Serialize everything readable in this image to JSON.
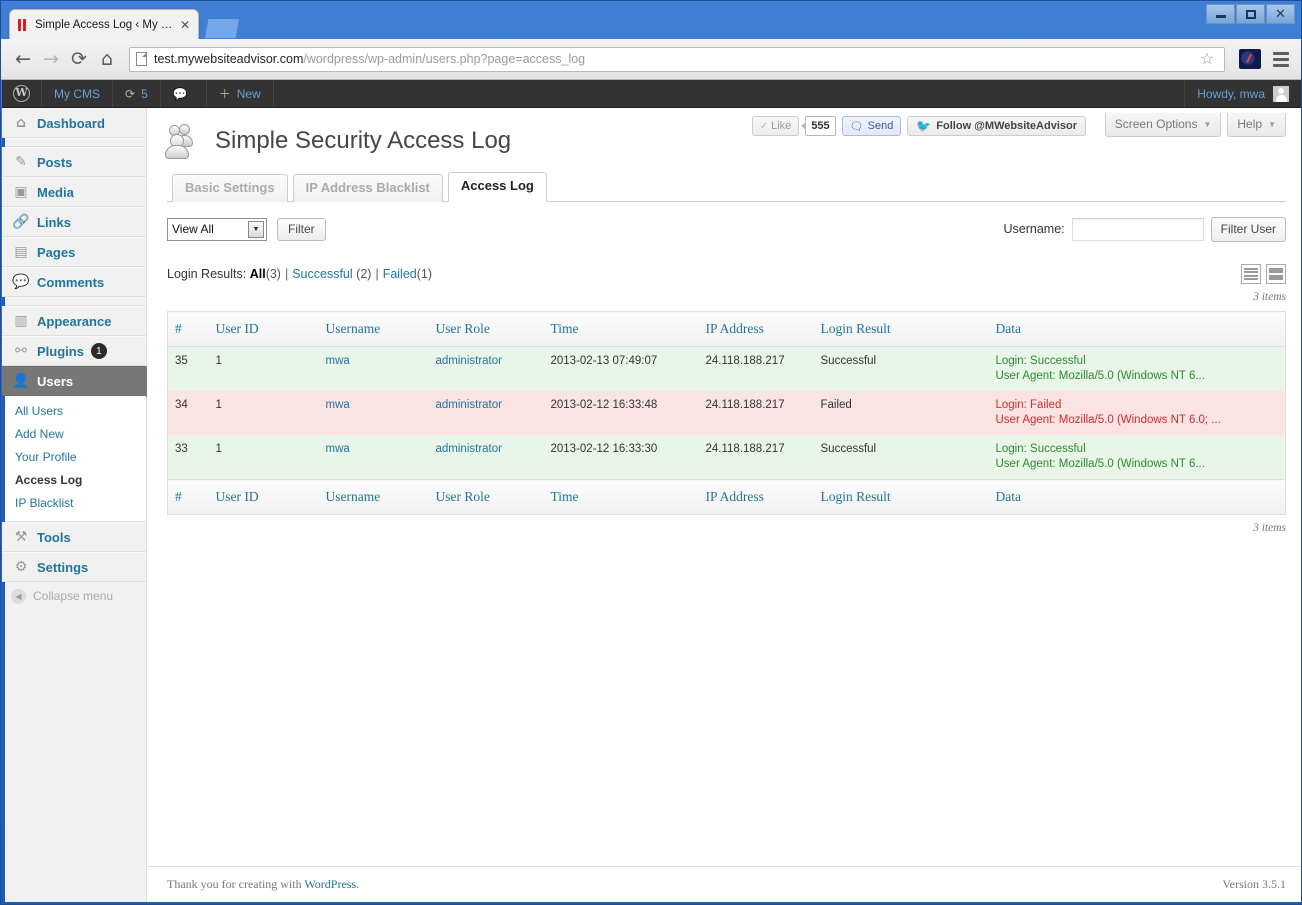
{
  "browser": {
    "tab_title": "Simple Access Log ‹ My CMS",
    "tab_close": "✕",
    "url_host": "test.mywebsiteadvisor.com",
    "url_path": "/wordpress/wp-admin/users.php?page=access_log",
    "back_glyph": "←",
    "forward_glyph": "→",
    "reload_glyph": "⟳",
    "home_glyph": "⌂",
    "star_glyph": "☆",
    "minimize_glyph": "",
    "maximize_glyph": "",
    "close_glyph": "✕"
  },
  "adminbar": {
    "wp_logo": "W",
    "site_name": "My CMS",
    "updates_icon": "⟳",
    "updates_count": "5",
    "comments_icon": "💬",
    "new_icon": "＋",
    "new_label": "New",
    "howdy": "Howdy, mwa"
  },
  "sidebar": {
    "items": [
      {
        "label": "Dashboard",
        "icon": "⌂",
        "badge": ""
      },
      {
        "label": "Posts",
        "icon": "✎",
        "badge": ""
      },
      {
        "label": "Media",
        "icon": "▣",
        "badge": ""
      },
      {
        "label": "Links",
        "icon": "🔗",
        "badge": ""
      },
      {
        "label": "Pages",
        "icon": "▤",
        "badge": ""
      },
      {
        "label": "Comments",
        "icon": "💬",
        "badge": ""
      },
      {
        "label": "Appearance",
        "icon": "▥",
        "badge": ""
      },
      {
        "label": "Plugins",
        "icon": "⚯",
        "badge": "1"
      },
      {
        "label": "Users",
        "icon": "👤",
        "badge": ""
      },
      {
        "label": "Tools",
        "icon": "⚒",
        "badge": ""
      },
      {
        "label": "Settings",
        "icon": "⚙",
        "badge": ""
      }
    ],
    "users_submenu": [
      {
        "label": "All Users",
        "current": false
      },
      {
        "label": "Add New",
        "current": false
      },
      {
        "label": "Your Profile",
        "current": false
      },
      {
        "label": "Access Log",
        "current": true
      },
      {
        "label": "IP Blacklist",
        "current": false
      }
    ],
    "collapse_label": "Collapse menu",
    "collapse_icon": "◀"
  },
  "screen_meta": {
    "screen_options": "Screen Options",
    "help": "Help",
    "caret": "▼"
  },
  "social": {
    "like_label": "Like",
    "like_check": "✓",
    "like_count": "555",
    "send_label": "Send",
    "send_icon": "🗨",
    "twitter_label": "Follow @MWebsiteAdvisor",
    "twitter_icon": "🐦"
  },
  "page": {
    "title": "Simple Security Access Log",
    "icon": "users-icon"
  },
  "tabs": [
    {
      "label": "Basic Settings",
      "active": false
    },
    {
      "label": "IP Address Blacklist",
      "active": false
    },
    {
      "label": "Access Log",
      "active": true
    }
  ],
  "filters": {
    "view_select_value": "View All",
    "view_select_options": [
      "View All"
    ],
    "select_arrow": "▼",
    "filter_button": "Filter",
    "username_label": "Username:",
    "username_value": "",
    "username_placeholder": "",
    "filter_user_button": "Filter User"
  },
  "subsubsub": {
    "prefix": "Login Results:",
    "links": [
      {
        "label": "All",
        "count": "(3)",
        "current": true
      },
      {
        "label": "Successful",
        "count": "(2)",
        "current": false
      },
      {
        "label": "Failed",
        "count": "(1)",
        "current": false
      }
    ],
    "separator": "|"
  },
  "view_switch": {
    "list_view": "list-view",
    "excerpt_view": "excerpt-view"
  },
  "counts": {
    "top_items": "3 items",
    "bottom_items": "3 items"
  },
  "table": {
    "columns": [
      "#",
      "User ID",
      "Username",
      "User Role",
      "Time",
      "IP Address",
      "Login Result",
      "Data"
    ],
    "rows": [
      {
        "num": "35",
        "user_id": "1",
        "username": "mwa",
        "user_role": "administrator",
        "time": "2013-02-13 07:49:07",
        "ip": "24.118.188.217",
        "result": "Successful",
        "data_line1": "Login: Successful",
        "data_line2": "User Agent: Mozilla/5.0 (Windows NT 6...",
        "status": "success"
      },
      {
        "num": "34",
        "user_id": "1",
        "username": "mwa",
        "user_role": "administrator",
        "time": "2013-02-12 16:33:48",
        "ip": "24.118.188.217",
        "result": "Failed",
        "data_line1": "Login: Failed",
        "data_line2": "User Agent: Mozilla/5.0 (Windows NT 6.0; ...",
        "status": "failed"
      },
      {
        "num": "33",
        "user_id": "1",
        "username": "mwa",
        "user_role": "administrator",
        "time": "2013-02-12 16:33:30",
        "ip": "24.118.188.217",
        "result": "Successful",
        "data_line1": "Login: Successful",
        "data_line2": "User Agent: Mozilla/5.0 (Windows NT 6...",
        "status": "success"
      }
    ]
  },
  "footer": {
    "thanks_prefix": "Thank you for creating with ",
    "wordpress_link": "WordPress",
    "thanks_suffix": ".",
    "version": "Version 3.5.1"
  },
  "colors": {
    "accent": "#21759b",
    "success": "#2c8a2c",
    "failed": "#d63638",
    "row_success_bg": "#eaf5ea",
    "row_failed_bg": "#fbe3e4",
    "adminbar_bg": "#333333",
    "chrome_blue": "#1f5ab3"
  }
}
